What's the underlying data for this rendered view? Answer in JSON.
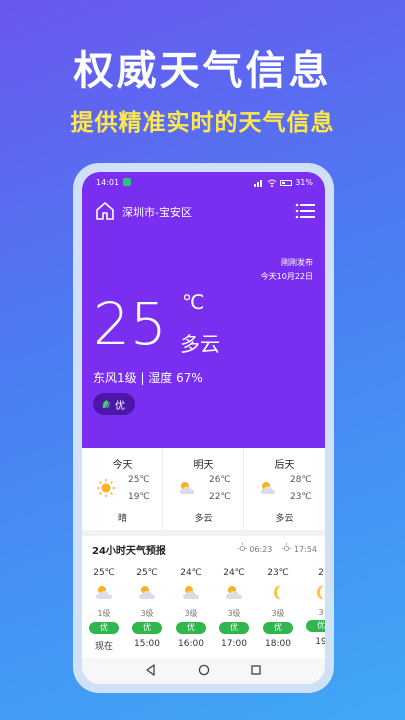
{
  "promo": {
    "title": "权威天气信息",
    "subtitle": "提供精准实时的天气信息"
  },
  "status_bar": {
    "time": "14:01",
    "battery": "31%"
  },
  "header": {
    "location": "深圳市-宝安区",
    "published": "刚刚发布",
    "date": "今天10月22日"
  },
  "current": {
    "temperature": "25",
    "unit": "℃",
    "condition": "多云",
    "wind_humidity": "东风1级 | 湿度 67%",
    "aqi": "优"
  },
  "days": [
    {
      "name": "今天",
      "high": "25℃",
      "low": "19℃",
      "desc": "晴",
      "icon": "sun-icon"
    },
    {
      "name": "明天",
      "high": "26℃",
      "low": "22℃",
      "desc": "多云",
      "icon": "partly-cloudy-icon"
    },
    {
      "name": "后天",
      "high": "28℃",
      "low": "23℃",
      "desc": "多云",
      "icon": "partly-cloudy-icon"
    }
  ],
  "forecast": {
    "title": "24小时天气预报",
    "sunrise": "06:23",
    "sunset": "17:54",
    "hours": [
      {
        "temp": "25℃",
        "level": "1级",
        "aqi": "优",
        "time": "现在",
        "icon": "partly-cloudy-icon"
      },
      {
        "temp": "25℃",
        "level": "3级",
        "aqi": "优",
        "time": "15:00",
        "icon": "partly-cloudy-icon"
      },
      {
        "temp": "24℃",
        "level": "3级",
        "aqi": "优",
        "time": "16:00",
        "icon": "partly-cloudy-icon"
      },
      {
        "temp": "24℃",
        "level": "3级",
        "aqi": "优",
        "time": "17:00",
        "icon": "partly-cloudy-icon"
      },
      {
        "temp": "23℃",
        "level": "3级",
        "aqi": "优",
        "time": "18:00",
        "icon": "moon-icon"
      },
      {
        "temp": "2",
        "level": "3",
        "aqi": "优",
        "time": "19",
        "icon": "moon-icon"
      }
    ]
  },
  "colors": {
    "hero": "#7a2ff0",
    "aqi_good": "#2fb64d",
    "subtitle": "#ffe94a"
  }
}
